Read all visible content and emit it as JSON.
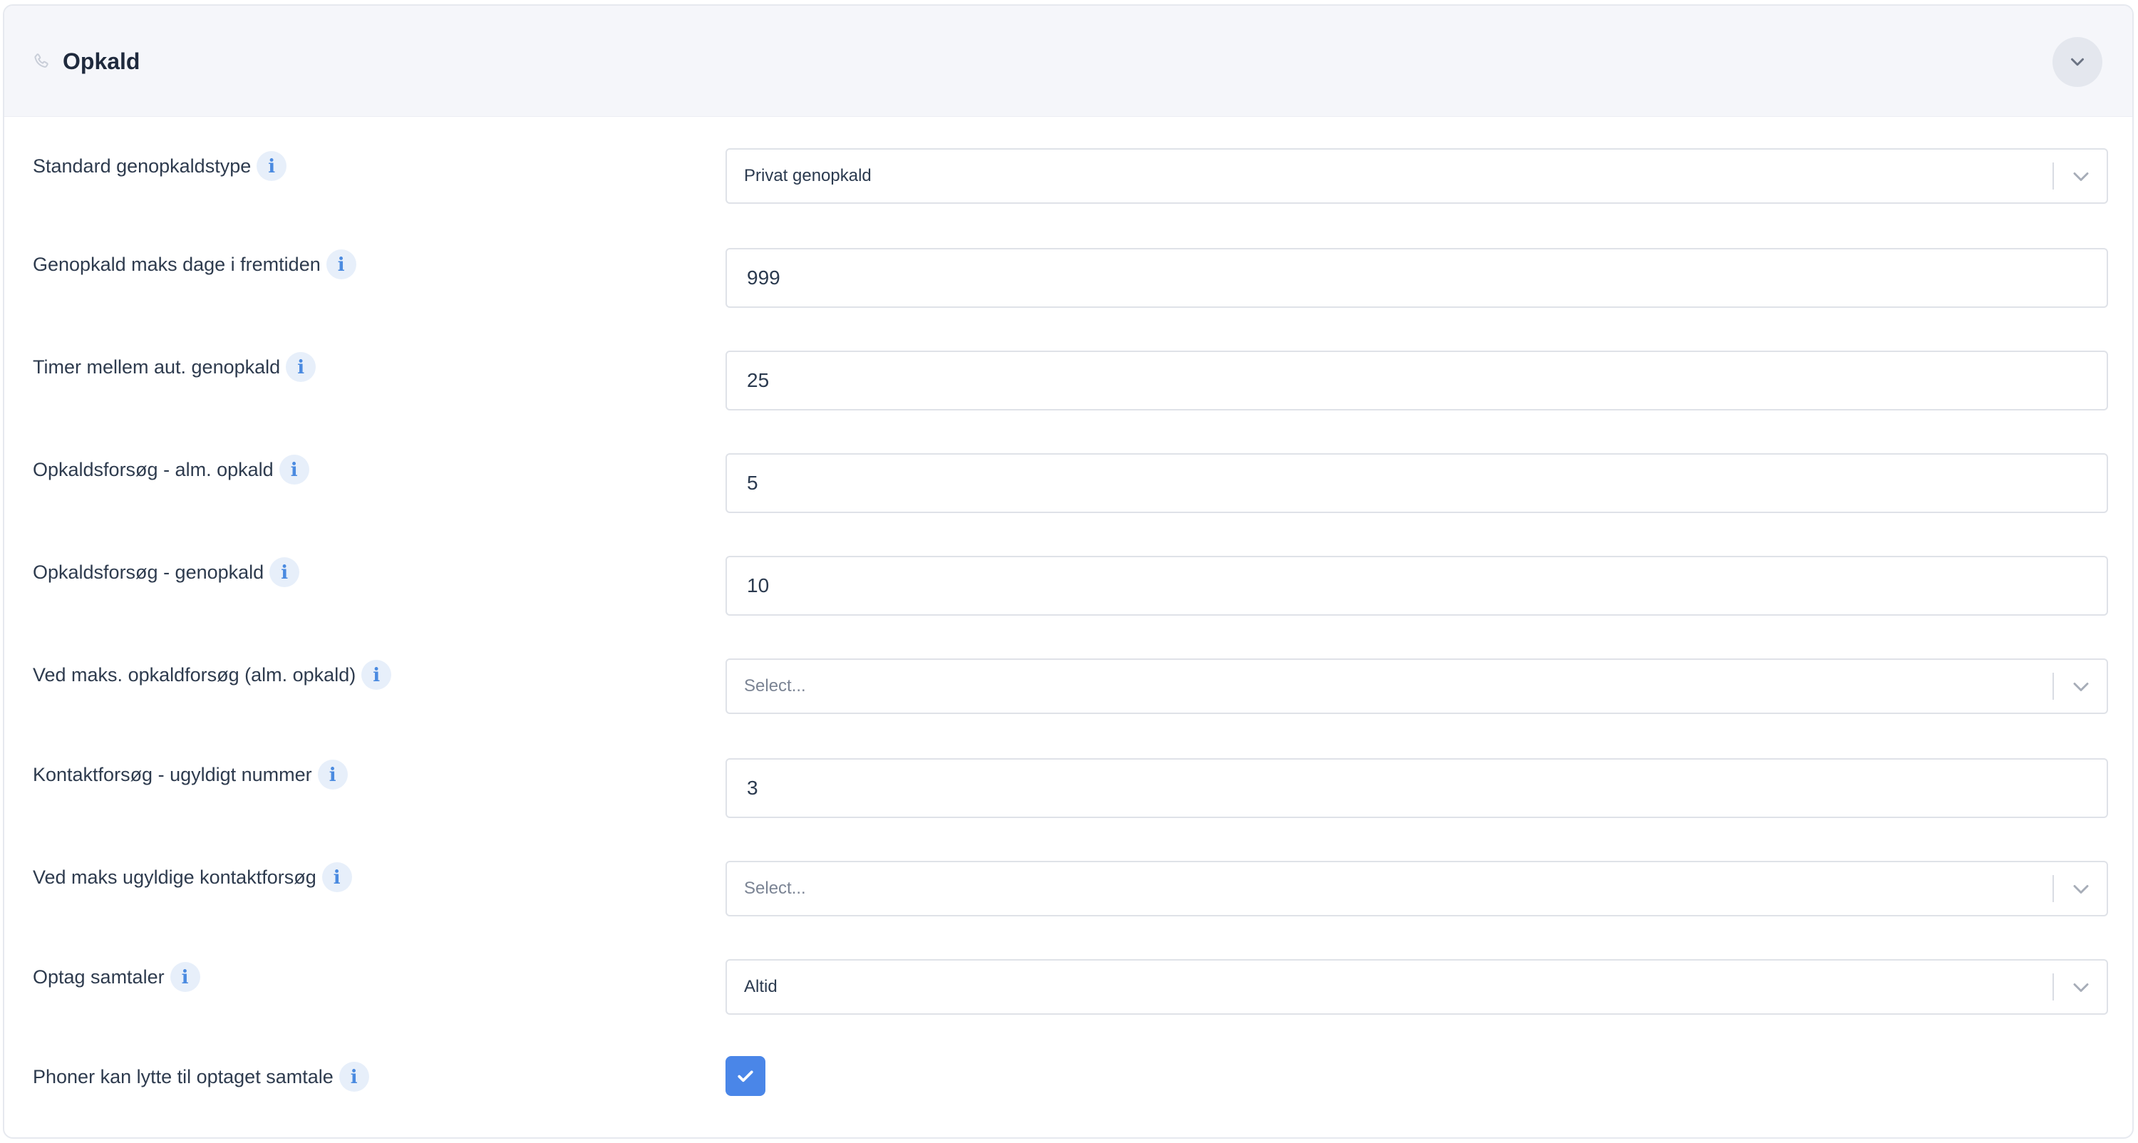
{
  "section": {
    "title": "Opkald",
    "icon": "phone-icon",
    "collapse_icon": "chevron-down-icon"
  },
  "fields": {
    "standard_genopkaldstype": {
      "label": "Standard genopkaldstype",
      "type": "select",
      "value": "Privat genopkald"
    },
    "genopkald_maks_dage": {
      "label": "Genopkald maks dage i fremtiden",
      "type": "input",
      "value": "999"
    },
    "timer_mellem_genopkald": {
      "label": "Timer mellem aut. genopkald",
      "type": "input",
      "value": "25"
    },
    "opkaldsforsoeg_alm": {
      "label": "Opkaldsforsøg - alm. opkald",
      "type": "input",
      "value": "5"
    },
    "opkaldsforsoeg_genopkald": {
      "label": "Opkaldsforsøg - genopkald",
      "type": "input",
      "value": "10"
    },
    "ved_maks_opkaldforsoeg": {
      "label": "Ved maks. opkaldforsøg (alm. opkald)",
      "type": "select",
      "placeholder": "Select..."
    },
    "kontaktforsoeg_ugyldigt": {
      "label": "Kontaktforsøg - ugyldigt nummer",
      "type": "input",
      "value": "3"
    },
    "ved_maks_ugyldige": {
      "label": "Ved maks ugyldige kontaktforsøg",
      "type": "select",
      "placeholder": "Select..."
    },
    "optag_samtaler": {
      "label": "Optag samtaler",
      "type": "select",
      "value": "Altid"
    },
    "phoner_kan_lytte": {
      "label": "Phoner kan lytte til optaget samtale",
      "type": "checkbox",
      "checked": true
    }
  },
  "icons": {
    "info": "info-icon",
    "dropdown": "chevron-down-icon",
    "check": "check-icon"
  },
  "colors": {
    "header_bg": "#f5f6fa",
    "accent": "#4a86e8",
    "info_icon": "#4a8ae0",
    "info_icon_bg": "#e7effa",
    "border": "#dfe2e8"
  }
}
